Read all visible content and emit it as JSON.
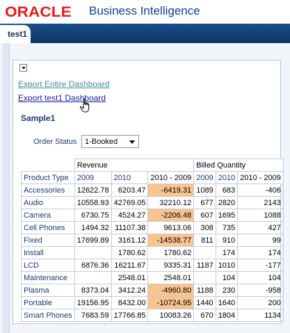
{
  "header": {
    "logo_text": "ORACLE",
    "app_title": "Business Intelligence"
  },
  "tabs": [
    {
      "label": "test1",
      "active": true
    }
  ],
  "section": {
    "links": {
      "export_entire": "Export Entire Dashboard",
      "export_page": "Export test1 Dashboard"
    },
    "view_title": "Sample1",
    "prompt": {
      "label": "Order Status",
      "selected": "1-Booked"
    }
  },
  "pivot": {
    "measures": [
      "Revenue",
      "Billed Quantity"
    ],
    "row_header_label": "Product Type",
    "columns": [
      "2009",
      "2010",
      "2010 - 2009"
    ],
    "rows": [
      {
        "label": "Accessories",
        "revenue": [
          "12622.78",
          "6203.47",
          "-6419.31"
        ],
        "quantity": [
          "1089",
          "683",
          "-406"
        ]
      },
      {
        "label": "Audio",
        "revenue": [
          "10558.93",
          "42769.05",
          "32210.12"
        ],
        "quantity": [
          "677",
          "2820",
          "2143"
        ]
      },
      {
        "label": "Camera",
        "revenue": [
          "6730.75",
          "4524.27",
          "-2206.48"
        ],
        "quantity": [
          "607",
          "1695",
          "1088"
        ]
      },
      {
        "label": "Cell Phones",
        "revenue": [
          "1494.32",
          "11107.38",
          "9613.06"
        ],
        "quantity": [
          "308",
          "735",
          "427"
        ]
      },
      {
        "label": "Fixed",
        "revenue": [
          "17699.89",
          "3161.12",
          "-14538.77"
        ],
        "quantity": [
          "811",
          "910",
          "99"
        ]
      },
      {
        "label": "Install",
        "revenue": [
          "",
          "1780.62",
          "1780.62"
        ],
        "quantity": [
          "",
          "174",
          "174"
        ]
      },
      {
        "label": "LCD",
        "revenue": [
          "6876.36",
          "16211.67",
          "9335.31"
        ],
        "quantity": [
          "1187",
          "1010",
          "-177"
        ]
      },
      {
        "label": "Maintenance",
        "revenue": [
          "",
          "2548.01",
          "2548.01"
        ],
        "quantity": [
          "",
          "104",
          "104"
        ]
      },
      {
        "label": "Plasma",
        "revenue": [
          "8373.04",
          "3412.24",
          "-4960.80"
        ],
        "quantity": [
          "1188",
          "230",
          "-958"
        ]
      },
      {
        "label": "Portable",
        "revenue": [
          "19156.95",
          "8432.00",
          "-10724.95"
        ],
        "quantity": [
          "1440",
          "1640",
          "200"
        ]
      },
      {
        "label": "Smart Phones",
        "revenue": [
          "7683.59",
          "17766.85",
          "10083.26"
        ],
        "quantity": [
          "670",
          "1804",
          "1134"
        ]
      }
    ],
    "highlight_color": "#f9c48f"
  },
  "colors": {
    "oracle_red": "#e21d17",
    "title_blue": "#0d3f8f",
    "tabbar_blue": "#0d3566"
  },
  "icons": {
    "collapse": "chevron-down-icon",
    "cursor": "hand-pointer-icon"
  }
}
